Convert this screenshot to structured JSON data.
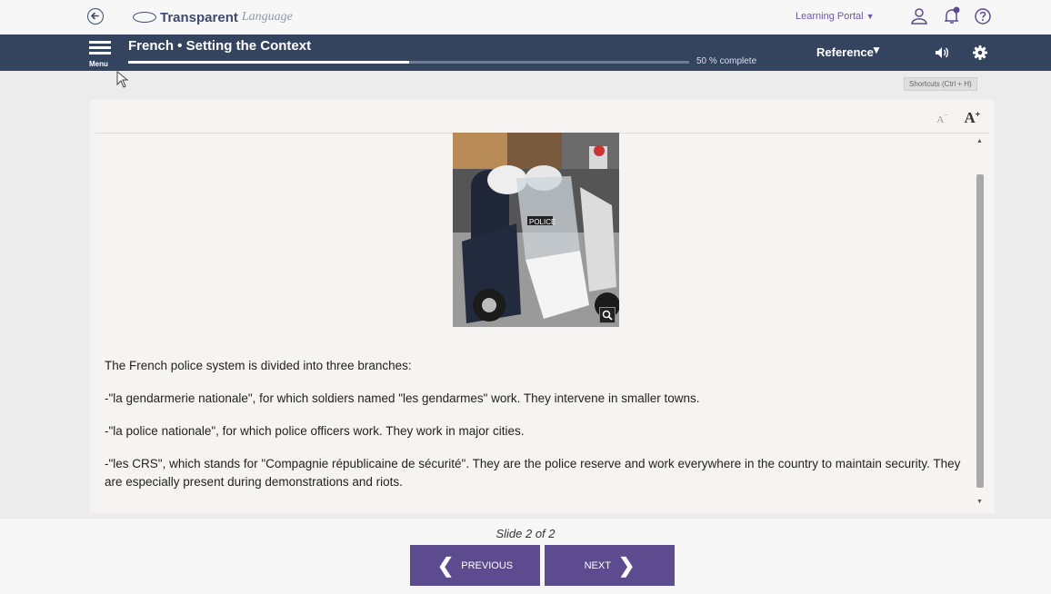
{
  "brand": {
    "name_bold": "Transparent",
    "name_italic": "Language"
  },
  "top_bar": {
    "portal_label": "Learning Portal",
    "icons": [
      "back-arrow-icon",
      "user-icon",
      "notification-bell-icon",
      "help-icon"
    ]
  },
  "nav_bar": {
    "menu_label": "Menu",
    "course_title": "French • Setting the Context",
    "progress_percent": 50,
    "progress_text": "50 % complete",
    "reference_label": "Reference",
    "icons": [
      "hamburger-icon",
      "chevron-down-icon",
      "speaker-icon",
      "gear-icon"
    ]
  },
  "shortcuts_label": "Shortcuts (Ctrl + H)",
  "font_tools": {
    "decrease_label": "A",
    "increase_label": "A"
  },
  "content": {
    "paragraphs": [
      "The French police system is divided into three branches:",
      "-\"la gendarmerie nationale\", for which soldiers named \"les gendarmes\" work. They intervene in smaller towns.",
      "-\"la police nationale\", for which police officers work. They work in major cities.",
      "-\"les CRS\", which stands for \"Compagnie républicaine de sécurité\". They are the police reserve and work everywhere in the country to maintain security. They are especially present during demonstrations and riots."
    ],
    "photo_shield_text": "POLICE"
  },
  "footer": {
    "slide_label": "Slide 2 of 2",
    "previous_label": "PREVIOUS",
    "next_label": "NEXT"
  },
  "colors": {
    "nav_bar": "#34445f",
    "accent_purple": "#5d4b8f",
    "portal_text": "#6b5aa1"
  }
}
